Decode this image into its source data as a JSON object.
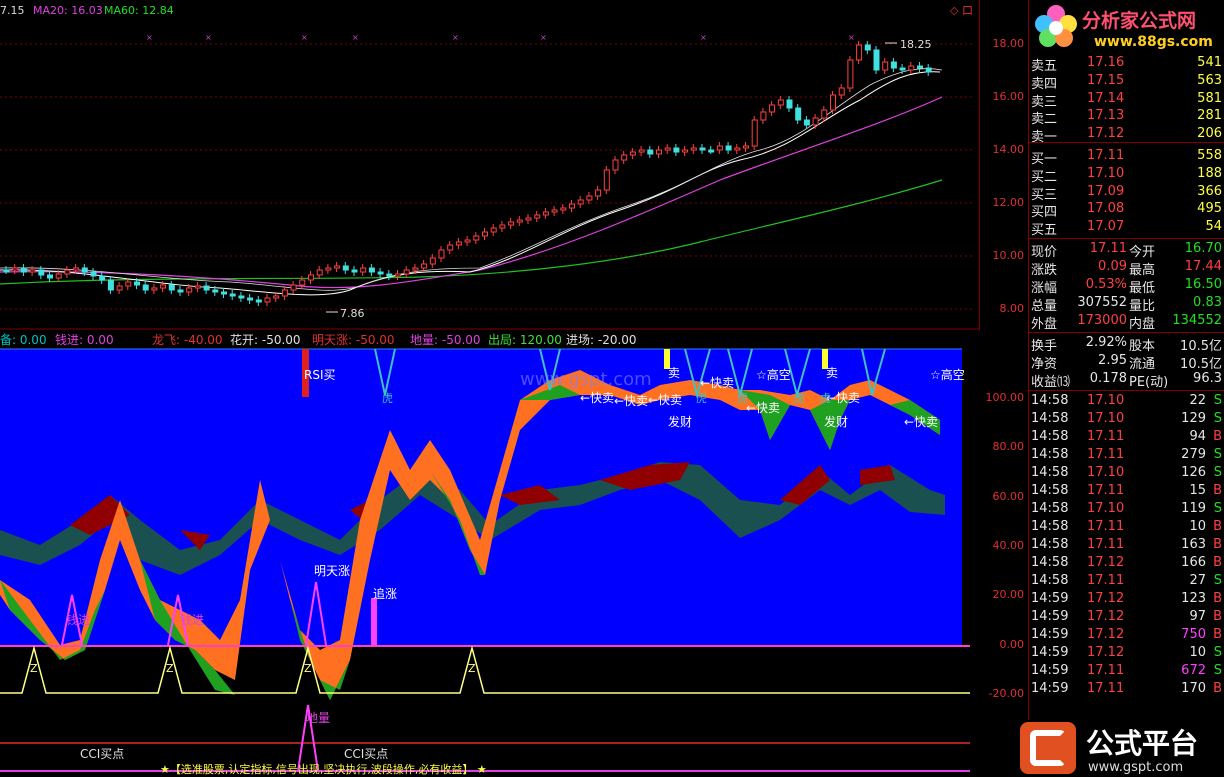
{
  "ma_legend": {
    "price": "7.15",
    "ma20": "MA20: 16.03",
    "ma60": "MA60: 12.84"
  },
  "top_right_icons": "◇ 口",
  "price_axis": [
    "18.00",
    "16.00",
    "14.00",
    "12.00",
    "10.00",
    "8.00"
  ],
  "price_markers": {
    "high": "18.25",
    "low": "7.86"
  },
  "indicator_legend": [
    {
      "text": "备: 0.00",
      "color": "#00c0c0"
    },
    {
      "text": "钱进: 0.00",
      "color": "#e040e0"
    },
    {
      "text": "龙飞: -40.00",
      "color": "#e03030"
    },
    {
      "text": "花开: -50.00",
      "color": "#e0e0e0"
    },
    {
      "text": "明天涨: -50.00",
      "color": "#e03030"
    },
    {
      "text": "地量: -50.00",
      "color": "#e040e0"
    },
    {
      "text": "出局: 120.00",
      "color": "#40e040"
    },
    {
      "text": "进场: -20.00",
      "color": "#e0e0e0"
    }
  ],
  "indicator_axis": [
    "100.00",
    "80.00",
    "60.00",
    "40.00",
    "20.00",
    "0.00",
    "-20.00"
  ],
  "chart_labels": {
    "rsi_buy": "RSI买",
    "tomorrow_up": "明天涨",
    "chase_up": "追涨",
    "money_in_1": "钱进",
    "money_in_2": "钱进",
    "z": "Z",
    "ground_vol": "地量",
    "cci_buy_1": "CCI买点",
    "cci_buy_2": "CCI买点",
    "banner": "★【选准股票,认定指标,信号出现,坚决执行,波段操作,必有收益】 ★",
    "fast_sell": "←快卖",
    "high_short": "☆高空",
    "fortune": "发财",
    "sell": "卖",
    "tiger": "虎",
    "watermark": "www.gspt.com"
  },
  "logo": {
    "title": "分析家公式网",
    "url": "www.88gs.com"
  },
  "logo_bottom": {
    "title": "公式平台",
    "url": "www.gspt.com"
  },
  "order_book": [
    {
      "label": "卖五",
      "price": "17.16",
      "vol": "541"
    },
    {
      "label": "卖四",
      "price": "17.15",
      "vol": "563"
    },
    {
      "label": "卖三",
      "price": "17.14",
      "vol": "581"
    },
    {
      "label": "卖二",
      "price": "17.13",
      "vol": "281"
    },
    {
      "label": "卖一",
      "price": "17.12",
      "vol": "206"
    },
    {
      "label": "买一",
      "price": "17.11",
      "vol": "558"
    },
    {
      "label": "买二",
      "price": "17.10",
      "vol": "188"
    },
    {
      "label": "买三",
      "price": "17.09",
      "vol": "366"
    },
    {
      "label": "买四",
      "price": "17.08",
      "vol": "495"
    },
    {
      "label": "买五",
      "price": "17.07",
      "vol": "54"
    }
  ],
  "quote": [
    {
      "l1": "现价",
      "v1": "17.11",
      "c1": "red",
      "l2": "今开",
      "v2": "16.70",
      "c2": "green"
    },
    {
      "l1": "涨跌",
      "v1": "0.09",
      "c1": "red",
      "l2": "最高",
      "v2": "17.44",
      "c2": "red"
    },
    {
      "l1": "涨幅",
      "v1": "0.53%",
      "c1": "red",
      "l2": "最低",
      "v2": "16.50",
      "c2": "green"
    },
    {
      "l1": "总量",
      "v1": "307552",
      "c1": "white",
      "l2": "量比",
      "v2": "0.83",
      "c2": "green"
    },
    {
      "l1": "外盘",
      "v1": "173000",
      "c1": "red",
      "l2": "内盘",
      "v2": "134552",
      "c2": "green"
    }
  ],
  "fundamentals": [
    {
      "l1": "换手",
      "v1": "2.92%",
      "l2": "股本",
      "v2": "10.5亿"
    },
    {
      "l1": "净资",
      "v1": "2.95",
      "l2": "流通",
      "v2": "10.5亿"
    },
    {
      "l1": "收益⒀",
      "v1": "0.178",
      "l2": "PE(动)",
      "v2": "96.3"
    }
  ],
  "ticks": [
    {
      "t": "14:58",
      "p": "17.10",
      "v": "22",
      "s": "S"
    },
    {
      "t": "14:58",
      "p": "17.10",
      "v": "129",
      "s": "S"
    },
    {
      "t": "14:58",
      "p": "17.11",
      "v": "94",
      "s": "B"
    },
    {
      "t": "14:58",
      "p": "17.11",
      "v": "279",
      "s": "S"
    },
    {
      "t": "14:58",
      "p": "17.10",
      "v": "126",
      "s": "S"
    },
    {
      "t": "14:58",
      "p": "17.11",
      "v": "15",
      "s": "B"
    },
    {
      "t": "14:58",
      "p": "17.10",
      "v": "119",
      "s": "S"
    },
    {
      "t": "14:58",
      "p": "17.11",
      "v": "10",
      "s": "B"
    },
    {
      "t": "14:58",
      "p": "17.11",
      "v": "163",
      "s": "B"
    },
    {
      "t": "14:58",
      "p": "17.12",
      "v": "166",
      "s": "B"
    },
    {
      "t": "14:58",
      "p": "17.11",
      "v": "27",
      "s": "S"
    },
    {
      "t": "14:59",
      "p": "17.12",
      "v": "123",
      "s": "B"
    },
    {
      "t": "14:59",
      "p": "17.12",
      "v": "97",
      "s": "B"
    },
    {
      "t": "14:59",
      "p": "17.12",
      "v": "750",
      "s": "B"
    },
    {
      "t": "14:59",
      "p": "17.12",
      "v": "10",
      "s": "S"
    },
    {
      "t": "14:59",
      "p": "17.11",
      "v": "672",
      "s": "S"
    },
    {
      "t": "14:59",
      "p": "17.11",
      "v": "170",
      "s": "B"
    }
  ]
}
